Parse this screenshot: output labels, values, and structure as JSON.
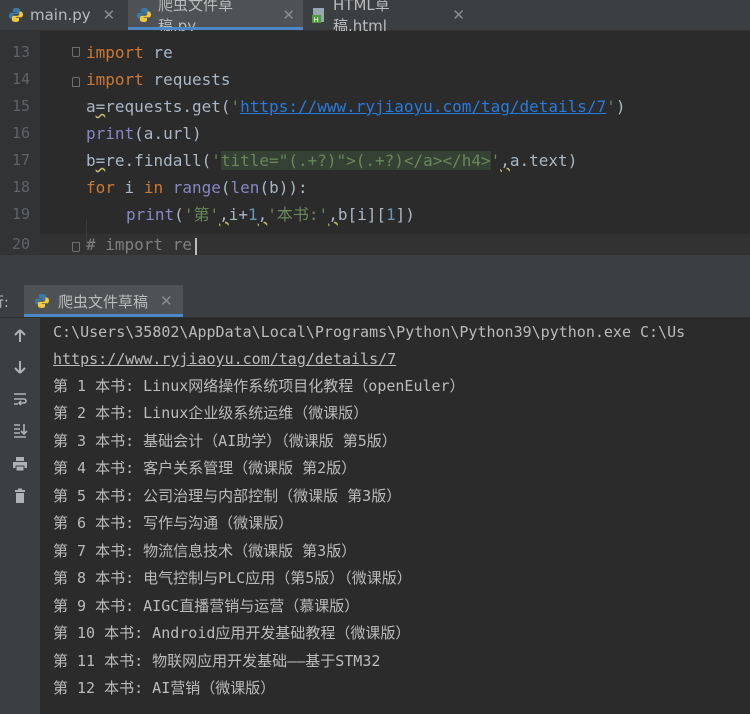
{
  "tabs": [
    {
      "label": "main.py",
      "icon": "python-file-icon",
      "active": false
    },
    {
      "label": "爬虫文件草稿.py",
      "icon": "python-file-icon",
      "active": true
    },
    {
      "label": "HTML草稿.html",
      "icon": "html-file-icon",
      "active": false
    }
  ],
  "close_glyph": "✕",
  "editor": {
    "line_numbers": [
      "13",
      "14",
      "15",
      "16",
      "17",
      "18",
      "19",
      "20"
    ],
    "lines": {
      "l13_kw": "import",
      "l13_rest": " re",
      "l14_kw": "import",
      "l14_rest": " requests",
      "l15_a": "a",
      "l15_eq": "=",
      "l15_mid": "requests.get(",
      "l15_q1": "'",
      "l15_url": "https://www.ryjiaoyu.com/tag/details/7",
      "l15_q2": "'",
      "l15_end": ")",
      "l16_print": "print",
      "l16_rest": "(a.url)",
      "l17_b": "b",
      "l17_eq": "=",
      "l17_mid": "re.findall(",
      "l17_q1": "'",
      "l17_rx": "title=\"(.+?)\">(.+?)</a></h4>",
      "l17_q2": "'",
      "l17_comma": ",",
      "l17_end": "a.text)",
      "l18_for": "for",
      "l18_i": " i ",
      "l18_in": "in",
      "l18_sp": " ",
      "l18_range": "range",
      "l18_p": "(",
      "l18_len": "len",
      "l18_end": "(b)):",
      "l19_print": "print",
      "l19_p": "(",
      "l19_s1": "'第'",
      "l19_c1": ",",
      "l19_mid": "i+",
      "l19_num": "1",
      "l19_c2": ",",
      "l19_s2": "'本书:'",
      "l19_c3": ",",
      "l19_end": "b[i][",
      "l19_num2": "1",
      "l19_close": "])",
      "l20": "# import re"
    }
  },
  "run": {
    "label": "行:",
    "tab_label": "爬虫文件草稿",
    "console_lines": [
      "C:\\Users\\35802\\AppData\\Local\\Programs\\Python\\Python39\\python.exe C:\\Us",
      "https://www.ryjiaoyu.com/tag/details/7",
      "第 1 本书: Linux网络操作系统项目化教程（openEuler）",
      "第 2 本书: Linux企业级系统运维（微课版）",
      "第 3 本书: 基础会计（AI助学）（微课版 第5版）",
      "第 4 本书: 客户关系管理（微课版 第2版）",
      "第 5 本书: 公司治理与内部控制（微课版 第3版）",
      "第 6 本书: 写作与沟通（微课版）",
      "第 7 本书: 物流信息技术（微课版 第3版）",
      "第 8 本书: 电气控制与PLC应用（第5版）（微课版）",
      "第 9 本书: AIGC直播营销与运营（慕课版）",
      "第 10 本书: Android应用开发基础教程（微课版）",
      "第 11 本书: 物联网应用开发基础——基于STM32",
      "第 12 本书: AI营销（微课版）"
    ]
  },
  "tools": [
    "rerun-up-icon",
    "scroll-down-icon",
    "soft-wrap-icon",
    "scroll-to-end-icon",
    "print-icon",
    "trash-icon"
  ],
  "colors": {
    "accent": "#4a88c7",
    "keyword": "#cc7832",
    "string": "#6a8759",
    "link": "#287bde"
  }
}
